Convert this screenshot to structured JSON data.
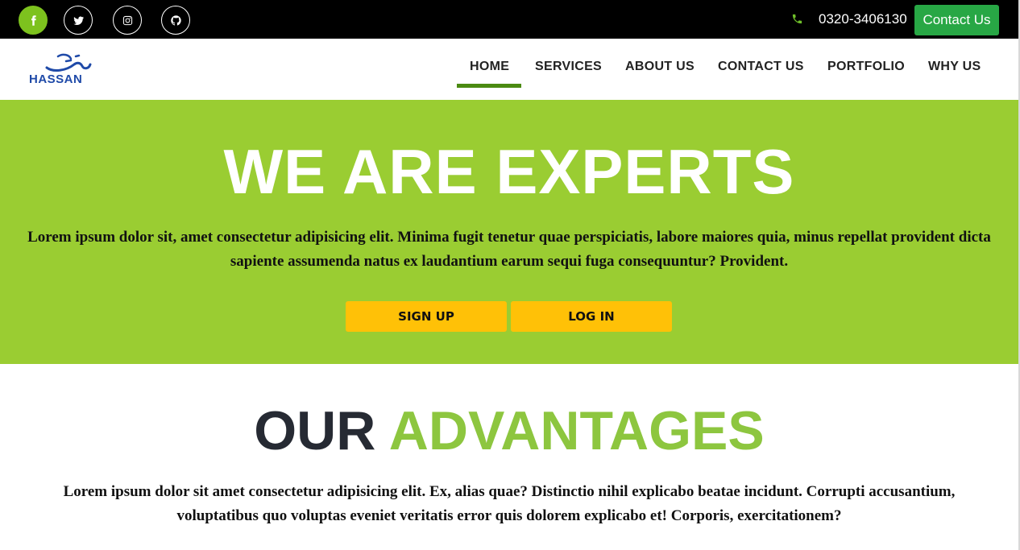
{
  "topbar": {
    "social": [
      {
        "icon": "facebook-icon"
      },
      {
        "icon": "twitter-icon"
      },
      {
        "icon": "instagram-icon"
      },
      {
        "icon": "github-icon"
      }
    ],
    "phone": "0320-3406130",
    "contact_label": "Contact Us"
  },
  "logo": {
    "text": "HASSAN"
  },
  "nav": {
    "items": [
      "HOME",
      "SERVICES",
      "ABOUT US",
      "CONTACT US",
      "PORTFOLIO",
      "WHY US"
    ],
    "active": "HOME"
  },
  "hero": {
    "title": "WE ARE EXPERTS",
    "text": "Lorem ipsum dolor sit, amet consectetur adipisicing elit. Minima fugit tenetur quae perspiciatis, labore maiores quia, minus repellat provident dicta sapiente assumenda natus ex laudantium earum sequi fuga consequuntur? Provident.",
    "signup_label": "SIGN UP",
    "login_label": "LOG IN"
  },
  "advantages": {
    "title_part1": "OUR",
    "title_part2": "ADVANTAGES",
    "text": "Lorem ipsum dolor sit amet consectetur adipisicing elit. Ex, alias quae? Distinctio nihil explicabo beatae incidunt. Corrupti accusantium, voluptatibus quo voluptas eveniet veritatis error quis dolorem explicabo et! Corporis, exercitationem?"
  },
  "colors": {
    "hero_bg": "#9acd32",
    "accent_green": "#8dc63f",
    "button_yellow": "#ffc107",
    "contact_green": "#28a745"
  }
}
